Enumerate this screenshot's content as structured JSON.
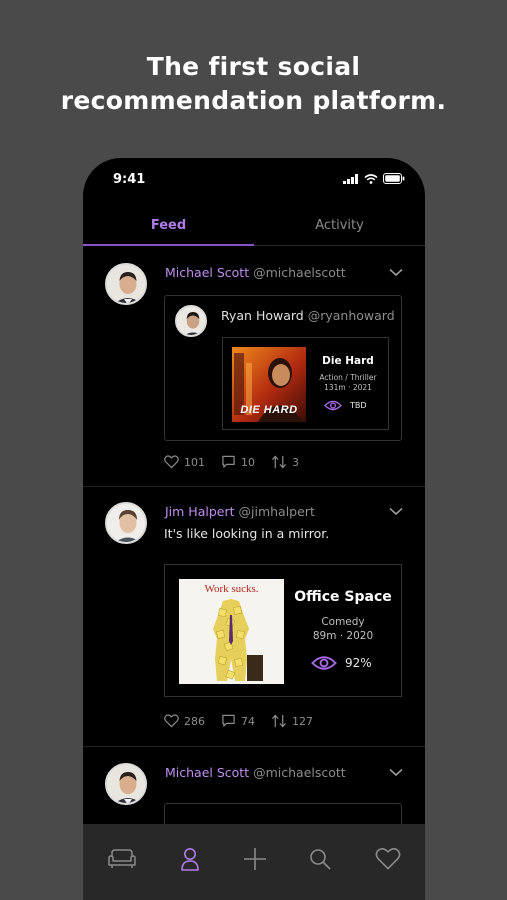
{
  "headline": {
    "line1": "The first social",
    "line2": "recommendation platform."
  },
  "status": {
    "time": "9:41"
  },
  "tabs": {
    "feed": "Feed",
    "activity": "Activity"
  },
  "posts": [
    {
      "name": "Michael Scott",
      "handle": "@michaelscott",
      "recommendation": {
        "name": "Ryan Howard",
        "handle": "@ryanhoward",
        "movie": {
          "title": "Die Hard",
          "genre": "Action / Thriller",
          "details": "131m · 2021",
          "score": "TBD",
          "poster_text": "DIE HARD"
        }
      },
      "likes": "101",
      "comments": "10",
      "shares": "3"
    },
    {
      "name": "Jim Halpert",
      "handle": "@jimhalpert",
      "text": "It's like looking in a mirror.",
      "movie": {
        "title": "Office Space",
        "genre": "Comedy",
        "details": "89m · 2020",
        "score": "92%",
        "poster_text": "Work sucks."
      },
      "likes": "286",
      "comments": "74",
      "shares": "127"
    },
    {
      "name": "Michael Scott",
      "handle": "@michaelscott"
    }
  ],
  "colors": {
    "accent": "#b07ae8",
    "background": "#000000",
    "nav": "#282828"
  }
}
